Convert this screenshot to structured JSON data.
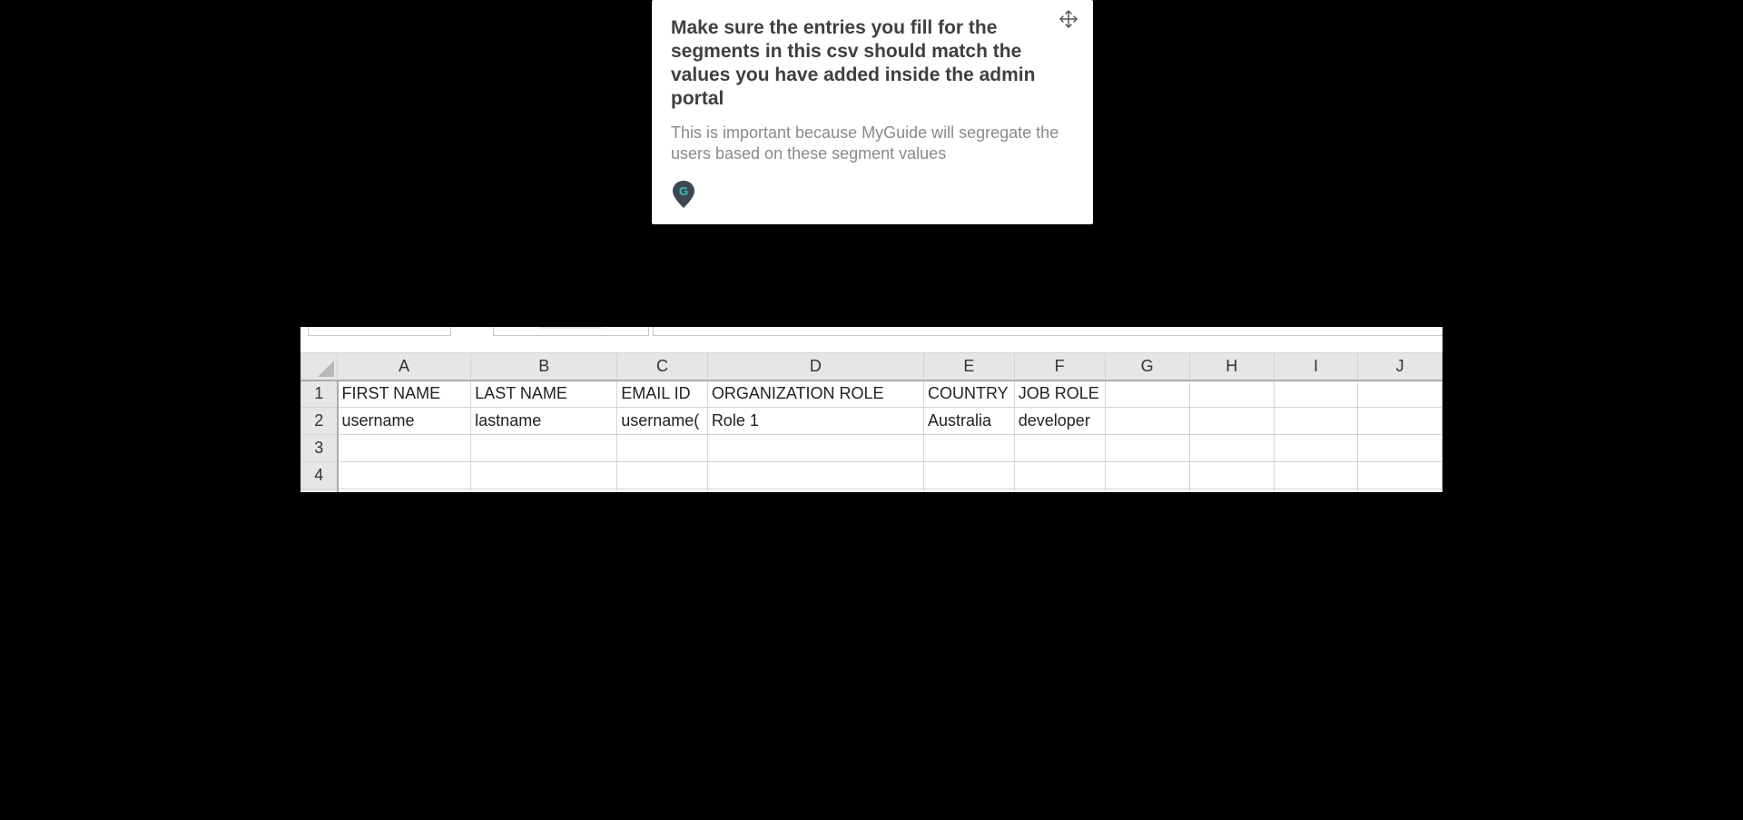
{
  "tooltip": {
    "title": "Make sure the entries you fill for the segments in this csv should match the values you have added inside the admin portal",
    "description": "This is important because MyGuide will segregate the users based on these segment values",
    "move_icon": "move-arrows-icon",
    "logo_icon": "myguide-pin-logo-icon",
    "logo_letter": "G"
  },
  "spreadsheet": {
    "columns": [
      "A",
      "B",
      "C",
      "D",
      "E",
      "F",
      "G",
      "H",
      "I",
      "J"
    ],
    "rows": [
      {
        "num": "1",
        "cells": [
          "FIRST NAME",
          "LAST NAME",
          "EMAIL ID",
          "ORGANIZATION ROLE",
          "COUNTRY",
          "JOB ROLE",
          "",
          "",
          "",
          ""
        ]
      },
      {
        "num": "2",
        "cells": [
          "username",
          "lastname",
          "username(",
          "Role 1",
          "Australia",
          "developer",
          "",
          "",
          "",
          ""
        ]
      },
      {
        "num": "3",
        "cells": [
          "",
          "",
          "",
          "",
          "",
          "",
          "",
          "",
          "",
          ""
        ]
      },
      {
        "num": "4",
        "cells": [
          "",
          "",
          "",
          "",
          "",
          "",
          "",
          "",
          "",
          ""
        ]
      },
      {
        "num": "",
        "cells": [
          "",
          "",
          "",
          "",
          "",
          "",
          "",
          "",
          "",
          ""
        ]
      }
    ]
  },
  "colors": {
    "background": "#000000",
    "tooltip_bg": "#ffffff",
    "title_color": "#3f3f3f",
    "desc_color": "#8a8a8a",
    "logo_teal": "#2ec4c6",
    "logo_dark": "#3d4752",
    "header_bg": "#e6e6e6"
  }
}
